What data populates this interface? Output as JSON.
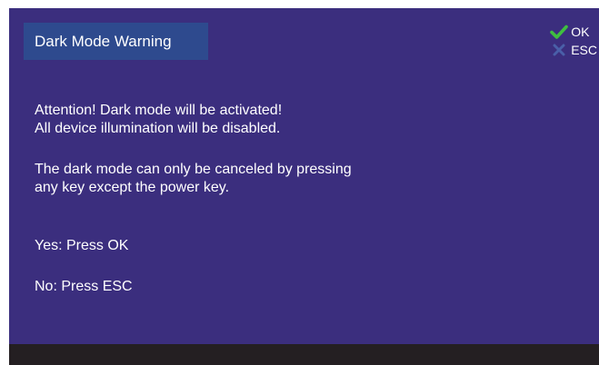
{
  "dialog": {
    "title": "Dark Mode Warning",
    "keys": [
      {
        "label": "OK",
        "icon": "check-icon",
        "color": "#3fbf3f"
      },
      {
        "label": "ESC",
        "icon": "x-icon",
        "color": "#4a5fa8"
      }
    ],
    "message_lines_1": [
      "Attention! Dark mode will be activated!",
      "All device illumination will be disabled."
    ],
    "message_lines_2": [
      "The dark mode can only be canceled by pressing",
      "any key except the power key."
    ],
    "yes_option": "Yes: Press OK",
    "no_option": "No: Press ESC"
  },
  "colors": {
    "background": "#3b2e7e",
    "title_box": "#2e4a8e",
    "bottom_bar": "#241f22",
    "text": "#ffffff"
  }
}
